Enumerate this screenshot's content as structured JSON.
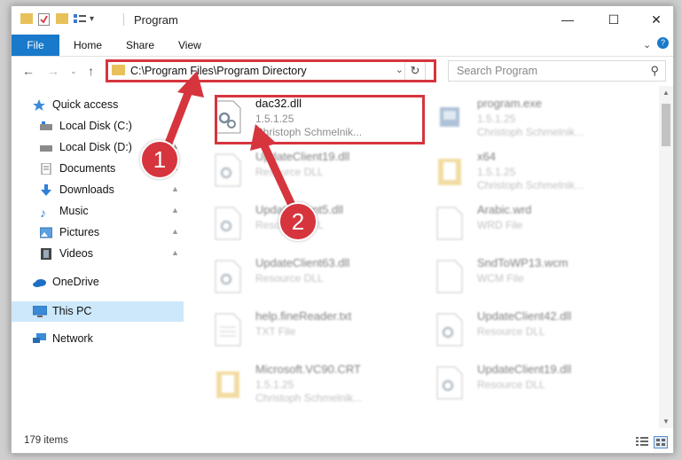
{
  "window": {
    "title": "Program"
  },
  "ribbon": {
    "file": "File",
    "home": "Home",
    "share": "Share",
    "view": "View"
  },
  "address": {
    "path": "C:\\Program Files\\Program Directory"
  },
  "search": {
    "placeholder": "Search Program"
  },
  "sidebar": {
    "items": [
      {
        "label": "Quick access"
      },
      {
        "label": "Local Disk (C:)"
      },
      {
        "label": "Local Disk (D:)"
      },
      {
        "label": "Documents"
      },
      {
        "label": "Downloads"
      },
      {
        "label": "Music"
      },
      {
        "label": "Pictures"
      },
      {
        "label": "Videos"
      },
      {
        "label": "OneDrive"
      },
      {
        "label": "This PC"
      },
      {
        "label": "Network"
      }
    ]
  },
  "files": [
    {
      "name": "dac32.dll",
      "line1": "1.5.1.25",
      "line2": "Christoph Schmelnik..."
    },
    {
      "name": "program.exe",
      "line1": "1.5.1.25",
      "line2": "Christoph Schmelnik..."
    },
    {
      "name": "UpdateClient19.dll",
      "line1": "Resource DLL",
      "line2": ""
    },
    {
      "name": "x64",
      "line1": "1.5.1.25",
      "line2": "Christoph Schmelnik..."
    },
    {
      "name": "UpdateClient5.dll",
      "line1": "Resource DLL",
      "line2": ""
    },
    {
      "name": "Arabic.wrd",
      "line1": "WRD File",
      "line2": ""
    },
    {
      "name": "UpdateClient63.dll",
      "line1": "Resource DLL",
      "line2": ""
    },
    {
      "name": "SndToWP13.wcm",
      "line1": "WCM File",
      "line2": ""
    },
    {
      "name": "help.fineReader.txt",
      "line1": "TXT File",
      "line2": ""
    },
    {
      "name": "UpdateClient42.dll",
      "line1": "Resource DLL",
      "line2": ""
    },
    {
      "name": "Microsoft.VC90.CRT",
      "line1": "1.5.1.25",
      "line2": "Christoph Schmelnik..."
    },
    {
      "name": "UpdateClient19.dll",
      "line1": "Resource DLL",
      "line2": ""
    }
  ],
  "status": {
    "count": "179 items"
  },
  "callouts": {
    "one": "1",
    "two": "2"
  },
  "colors": {
    "accent": "#1979ca",
    "highlight": "#d6353e",
    "selection": "#cde8fb",
    "folder": "#e8c15a"
  }
}
